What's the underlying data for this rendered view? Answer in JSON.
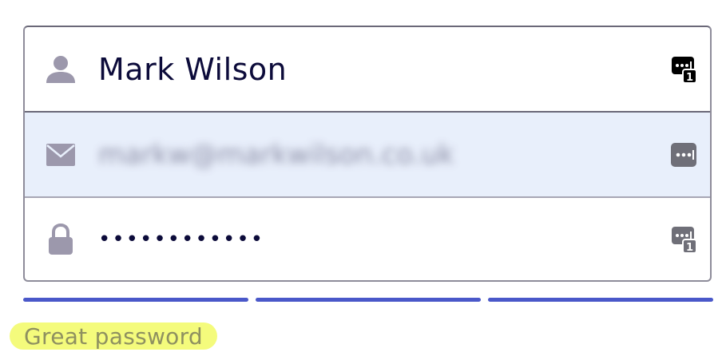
{
  "form": {
    "name_value": "Mark Wilson",
    "email_value": "markw@markwilson.co.uk",
    "password_value": "••••••••••••",
    "password_manager_badge": "1"
  },
  "strength": {
    "level": 3,
    "max": 3,
    "label": "Great password"
  },
  "colors": {
    "text_primary": "#0c0b3a",
    "email_row_background": "#e8effb",
    "strength_bar": "#4a58c9",
    "highlight": "#f4fb7c",
    "field_icon": "#9c98ac"
  }
}
